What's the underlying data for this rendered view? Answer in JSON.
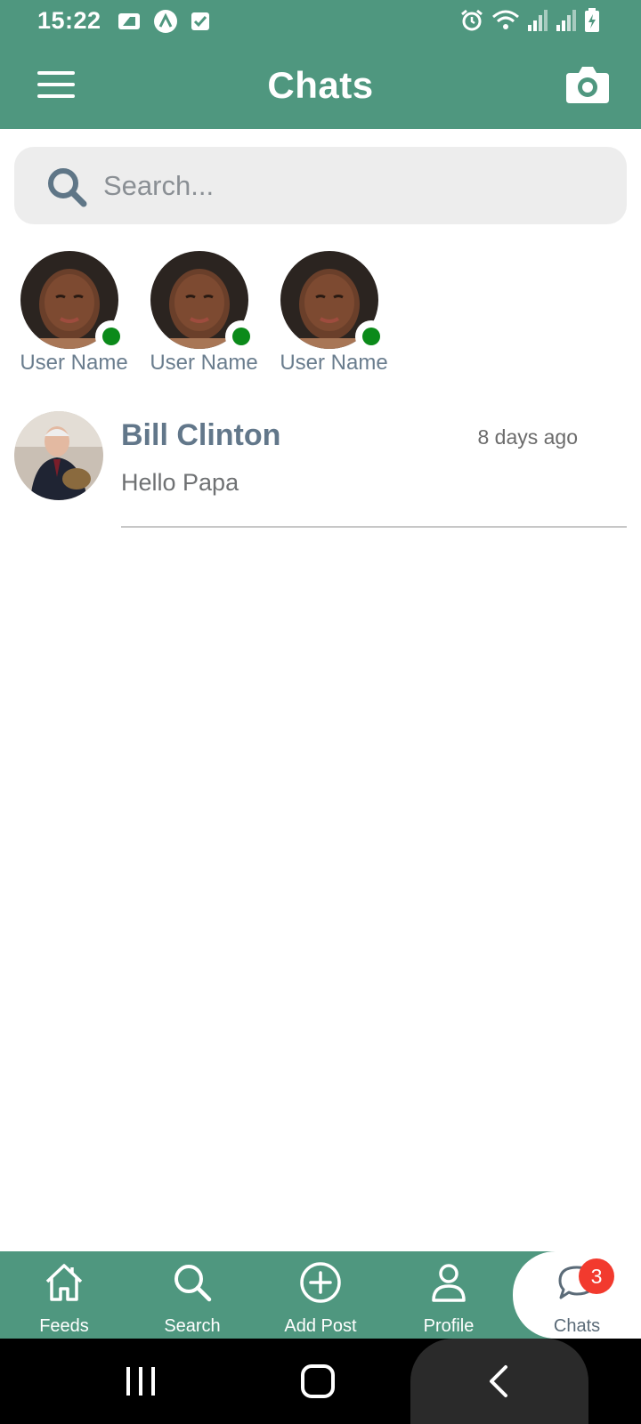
{
  "status_bar": {
    "time": "15:22",
    "left_icons": [
      "sim-card-icon",
      "app-logo-icon",
      "checkbox-icon"
    ],
    "right_icons": [
      "alarm-icon",
      "wifi-icon",
      "signal-icon",
      "signal-icon",
      "battery-charging-icon"
    ]
  },
  "app_bar": {
    "title": "Chats",
    "menu_icon": "hamburger-menu-icon",
    "camera_icon": "camera-icon"
  },
  "search": {
    "placeholder": "Search...",
    "value": ""
  },
  "stories": [
    {
      "name": "User Name",
      "online": true
    },
    {
      "name": "User Name",
      "online": true
    },
    {
      "name": "User Name",
      "online": true
    }
  ],
  "chats": [
    {
      "name": "Bill Clinton",
      "time": "8 days ago",
      "last_message": "Hello Papa"
    }
  ],
  "bottom_nav": {
    "items": [
      {
        "label": "Feeds",
        "icon": "home-icon"
      },
      {
        "label": "Search",
        "icon": "search-icon"
      },
      {
        "label": "Add Post",
        "icon": "add-circle-icon"
      },
      {
        "label": "Profile",
        "icon": "user-icon"
      },
      {
        "label": "Chats",
        "icon": "chat-bubble-icon",
        "badge": "3",
        "active": true
      }
    ]
  },
  "colors": {
    "primary": "#4f977f",
    "online": "#0b8a1a",
    "badge": "#f23a2e",
    "text": "#5b6b78"
  }
}
